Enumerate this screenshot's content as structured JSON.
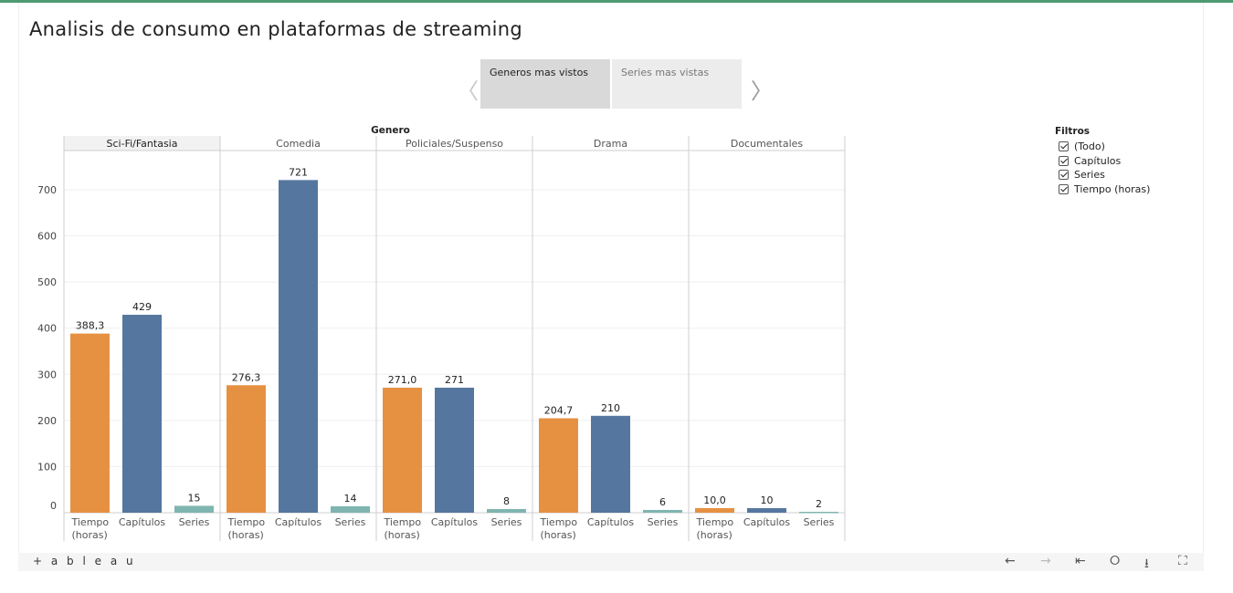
{
  "dashboard": {
    "title": "Analisis de consumo en plataformas de streaming"
  },
  "story": {
    "tabs": [
      {
        "label": "Generos mas vistos",
        "active": true
      },
      {
        "label": "Series mas vistas",
        "active": false
      }
    ],
    "prev_icon": "chevron-left-icon",
    "next_icon": "chevron-right-icon"
  },
  "filters": {
    "title": "Filtros",
    "items": [
      {
        "label": "(Todo)",
        "checked": true
      },
      {
        "label": "Capítulos",
        "checked": true
      },
      {
        "label": "Series",
        "checked": true
      },
      {
        "label": "Tiempo (horas)",
        "checked": true
      }
    ]
  },
  "footer": {
    "logo": "+ a b l e a u",
    "icons": [
      "undo-icon",
      "redo-icon",
      "revert-icon",
      "share-icon",
      "download-icon",
      "fullscreen-icon"
    ]
  },
  "colors": {
    "Tiempo (horas)": "#e69142",
    "Capítulos": "#55779f",
    "Series": "#7fb5b0",
    "topbar": "#4e9a70"
  },
  "chart_data": {
    "type": "bar",
    "group_header": "Genero",
    "groups": [
      "Sci-Fi/Fantasia",
      "Comedia",
      "Policiales/Suspenso",
      "Drama",
      "Documentales"
    ],
    "measures": [
      "Tiempo (horas)",
      "Capítulos",
      "Series"
    ],
    "measure_tick_labels": [
      [
        "Tiempo",
        "(horas)"
      ],
      [
        "Capítulos"
      ],
      [
        "Series"
      ]
    ],
    "series": [
      {
        "name": "Tiempo (horas)",
        "values": [
          388.3,
          276.3,
          271.0,
          204.7,
          10.0
        ],
        "labels": [
          "388,3",
          "276,3",
          "271,0",
          "204,7",
          "10,0"
        ]
      },
      {
        "name": "Capítulos",
        "values": [
          429,
          721,
          271,
          210,
          10
        ],
        "labels": [
          "429",
          "721",
          "271",
          "210",
          "10"
        ]
      },
      {
        "name": "Series",
        "values": [
          15,
          14,
          8,
          6,
          2
        ],
        "labels": [
          "15",
          "14",
          "8",
          "6",
          "2"
        ]
      }
    ],
    "y_ticks": [
      0,
      100,
      200,
      300,
      400,
      500,
      600,
      700
    ],
    "ylim": [
      0,
      785
    ],
    "grid": true,
    "highlighted_group": "Sci-Fi/Fantasia"
  }
}
